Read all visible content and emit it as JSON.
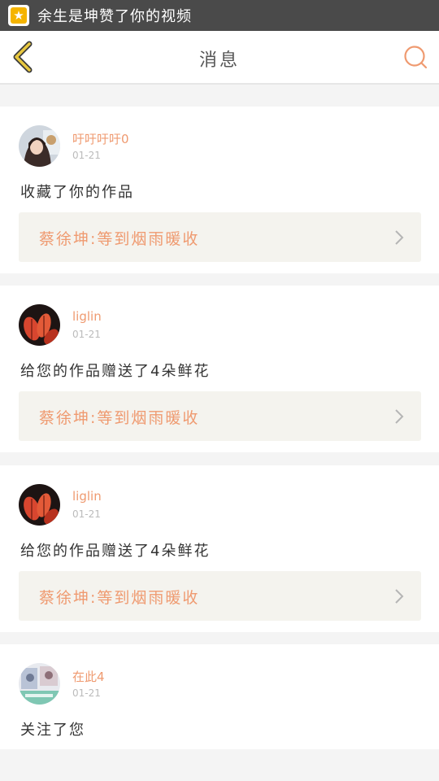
{
  "status_bar": {
    "notification_icon": "star-badge-icon",
    "notification_text": "余生是坤赞了你的视频"
  },
  "header": {
    "title": "消息",
    "back_icon": "chevron-left-icon",
    "search_icon": "search-icon"
  },
  "colors": {
    "accent": "#ef9a70",
    "back_arrow": "#e8c840",
    "link_box_bg": "#f4f3ee"
  },
  "messages": [
    {
      "username": "吁吁吁吁0",
      "date": "01-21",
      "action": "收藏了你的作品",
      "work_title": "蔡徐坤:等到烟雨暖收",
      "avatar_icon": "avatar-girl-portrait"
    },
    {
      "username": "liglin",
      "date": "01-21",
      "action": "给您的作品赠送了4朵鲜花",
      "work_title": "蔡徐坤:等到烟雨暖收",
      "avatar_icon": "avatar-red-leaves"
    },
    {
      "username": "liglin",
      "date": "01-21",
      "action": "给您的作品赠送了4朵鲜花",
      "work_title": "蔡徐坤:等到烟雨暖收",
      "avatar_icon": "avatar-red-leaves"
    },
    {
      "username": "在此4",
      "date": "01-21",
      "action": "关注了您",
      "avatar_icon": "avatar-photo-collage"
    }
  ]
}
